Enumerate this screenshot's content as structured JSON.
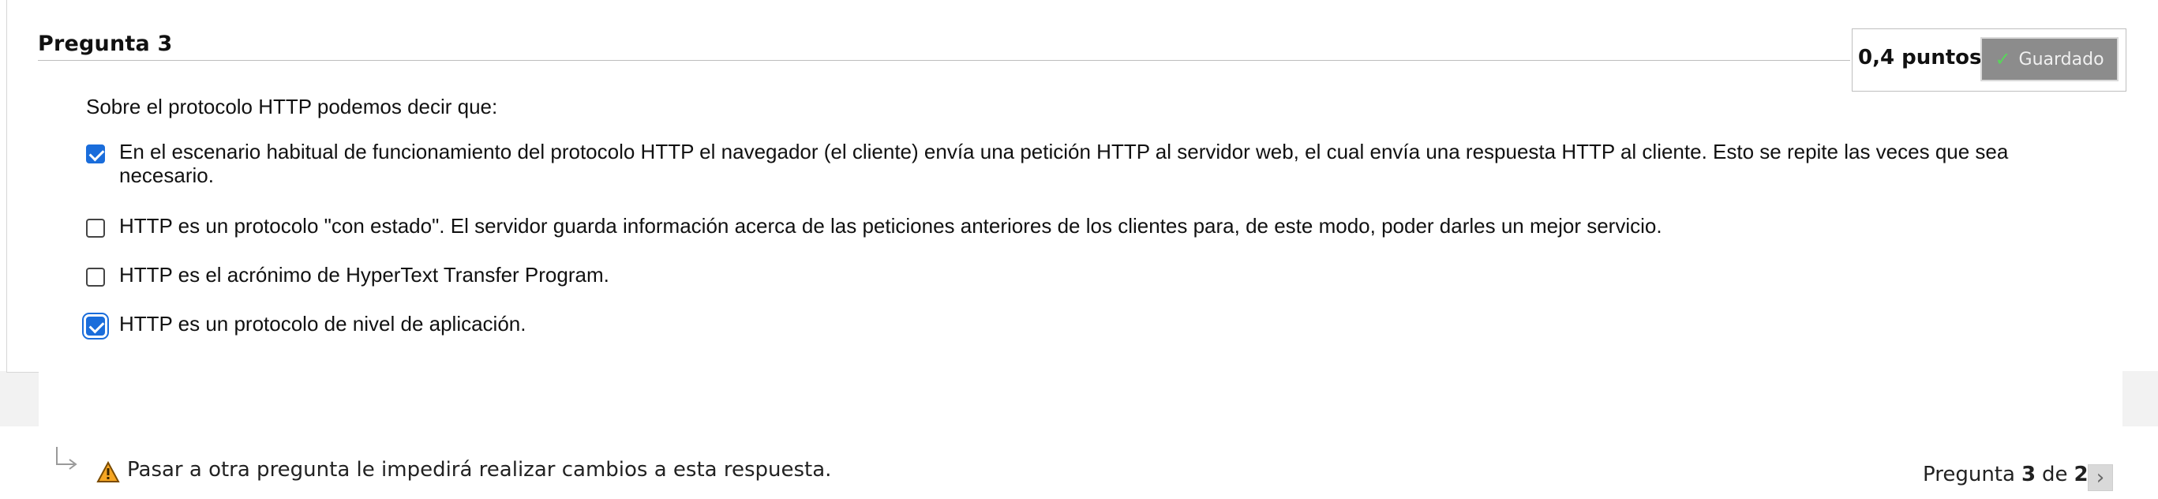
{
  "question": {
    "title": "Pregunta 3",
    "points": "0,4 puntos",
    "status_label": "Guardado",
    "prompt": "Sobre el protocolo HTTP podemos decir que:",
    "options": [
      {
        "text": "En el escenario habitual de funcionamiento del protocolo HTTP el navegador (el cliente) envía una petición HTTP al servidor web, el cual envía una respuesta HTTP al cliente. Esto se repite las veces que sea necesario.",
        "checked": true
      },
      {
        "text": "HTTP es un protocolo \"con estado\". El servidor guarda información acerca de las peticiones anteriores de los clientes para, de este modo, poder darles un mejor servicio.",
        "checked": false
      },
      {
        "text": "HTTP es el acrónimo de HyperText Transfer Program.",
        "checked": false
      },
      {
        "text": "HTTP es un protocolo de nivel de aplicación.",
        "checked": true
      }
    ]
  },
  "footer": {
    "warning_text": "Pasar a otra pregunta le impedirá realizar cambios a esta respuesta.",
    "counter_prefix": "Pregunta",
    "counter_current": "3",
    "counter_mid": "de",
    "counter_total": "26"
  },
  "icons": {
    "saved_check": "check-icon",
    "warning": "warning-icon",
    "next": "chevron-right-icon",
    "return_arrow": "return-arrow-icon"
  },
  "colors": {
    "accent": "#1a6ddb",
    "saved_button_bg": "#8c8c8c",
    "saved_check": "#58d65a",
    "warning_fill": "#f6a623"
  }
}
